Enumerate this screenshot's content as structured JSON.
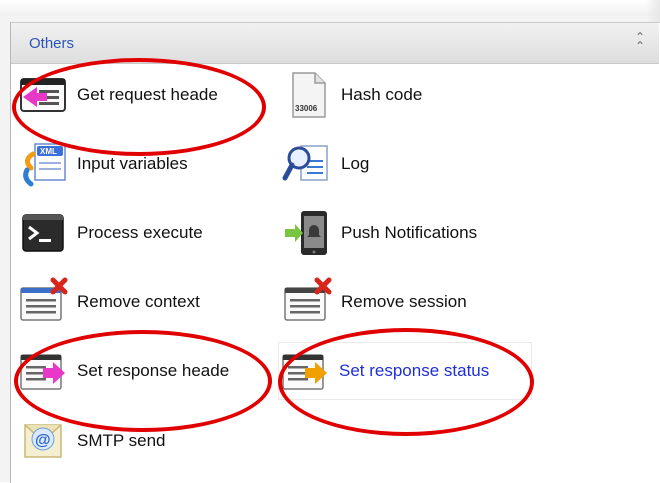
{
  "panel": {
    "title": "Others",
    "collapse_icon": "double-chevron-up-icon"
  },
  "items": [
    {
      "label": "Get request heade",
      "icon": "get-request-header-icon"
    },
    {
      "label": "Hash code",
      "icon": "hash-code-file-icon",
      "icon_text": "33006"
    },
    {
      "label": "Input variables",
      "icon": "xml-input-variables-icon",
      "icon_text": "XML"
    },
    {
      "label": "Log",
      "icon": "log-magnifier-icon"
    },
    {
      "label": "Process execute",
      "icon": "terminal-icon"
    },
    {
      "label": "Push Notifications",
      "icon": "push-notification-phone-icon"
    },
    {
      "label": "Remove context",
      "icon": "remove-context-icon"
    },
    {
      "label": "Remove session",
      "icon": "remove-session-icon"
    },
    {
      "label": "Set response heade",
      "icon": "set-response-header-icon"
    },
    {
      "label": "Set response status",
      "icon": "set-response-status-icon"
    },
    {
      "label": "SMTP send",
      "icon": "smtp-mail-icon"
    }
  ],
  "colors": {
    "title_blue": "#2b55b8",
    "highlight_label": "#1f2fd6",
    "annotation_red": "#e00000",
    "magenta_arrow": "#e838c8",
    "orange_arrow": "#f0a000",
    "remove_red": "#d9241c"
  }
}
